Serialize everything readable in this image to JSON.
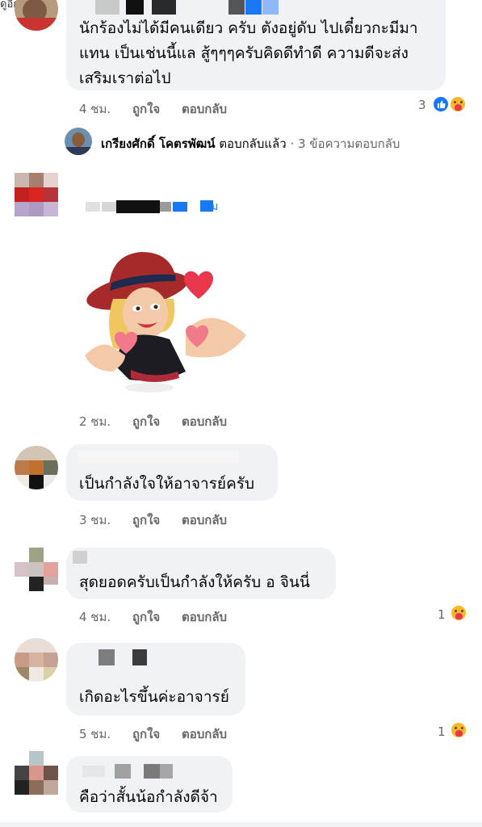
{
  "top_label": "ดูอีก",
  "comments": [
    {
      "text_lines": [
        "นักร้องไม่ได้มีคนเดียว ครับ ตังอยู่ดับ ไปเดี๋ยวกะมีมา",
        "แทน เป็นเช่นนี้แล สู้ๆๆๆครับคิดดีทำดี ความดีจะส่ง",
        "เสริมเราต่อไป"
      ],
      "time": "4 ชม.",
      "like": "ถูกใจ",
      "reply": "ตอบกลับ",
      "reaction_count": "3"
    },
    {
      "time": "2 ชม.",
      "like": "ถูกใจ",
      "reply": "ตอบกลับ",
      "partial_name_text": "ม"
    },
    {
      "text": "เป็นกำลังใจให้อาจารย์ครับ",
      "time": "3 ชม.",
      "like": "ถูกใจ",
      "reply": "ตอบกลับ"
    },
    {
      "text": "สุดยอดครับเป็นกำลังให้ครับ อ จินนี่",
      "time": "4 ชม.",
      "like": "ถูกใจ",
      "reply": "ตอบกลับ",
      "reaction_count": "1"
    },
    {
      "text": "เกิดอะไรขึ้นค่ะอาจารย์",
      "time": "5 ชม.",
      "like": "ถูกใจ",
      "reply": "ตอบกลับ",
      "reaction_count": "1"
    },
    {
      "text": "คือว่าสั้นน้อกำลังดีจ้า"
    }
  ],
  "reply_summary": {
    "name": "เกรียงศักดิ์ โคตรพัฒน์",
    "action": "ตอบกลับแล้ว",
    "count": "· 3 ข้อความตอบกลับ"
  },
  "colors": {
    "bubble": "#f0f2f5",
    "meta_text": "#65676b",
    "like_blue": "#1877f2"
  },
  "icons": [
    "like-icon",
    "care-icon",
    "sticker-image"
  ]
}
